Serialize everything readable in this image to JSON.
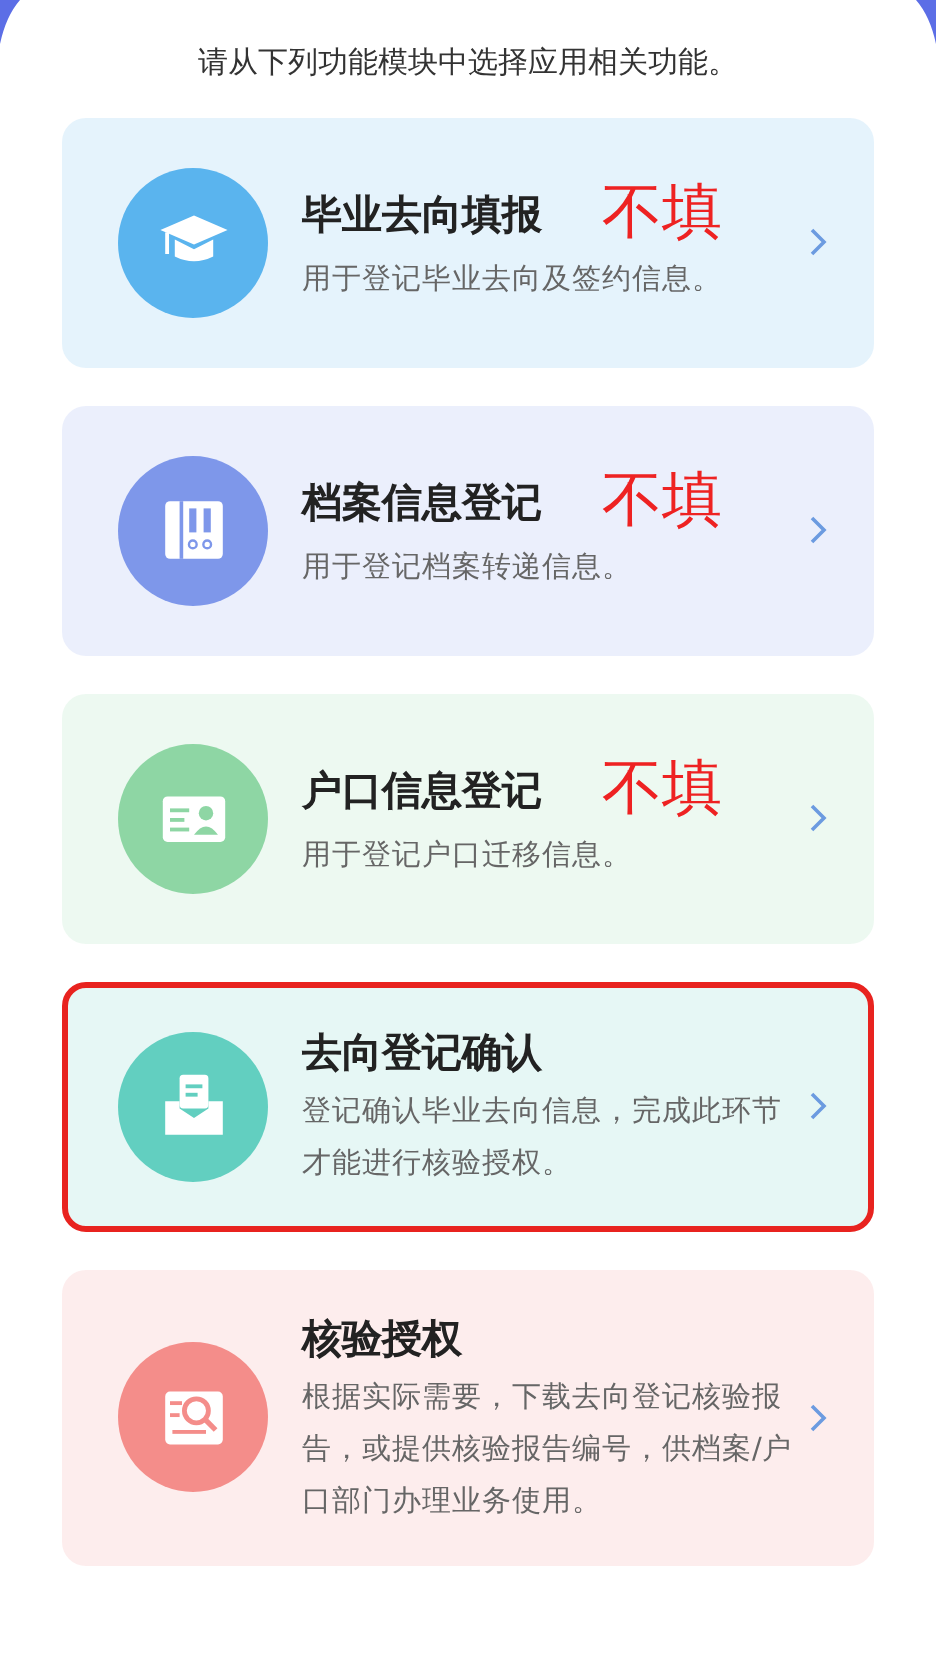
{
  "intro": "请从下列功能模块中选择应用相关功能。",
  "cards": [
    {
      "kind": "cap",
      "title": "毕业去向填报",
      "note": "不填",
      "description": "用于登记毕业去向及签约信息。",
      "color": "#5ab4ee",
      "highlighted": false
    },
    {
      "kind": "binder",
      "title": "档案信息登记",
      "note": "不填",
      "description": "用于登记档案转递信息。",
      "color": "#7e97ea",
      "highlighted": false
    },
    {
      "kind": "idcard",
      "title": "户口信息登记",
      "note": "不填",
      "description": "用于登记户口迁移信息。",
      "color": "#8ed6a4",
      "highlighted": false
    },
    {
      "kind": "envelope",
      "title": "去向登记确认",
      "description": "登记确认毕业去向信息，完成此环节才能进行核验授权。",
      "color": "#62cfc0",
      "highlighted": true
    },
    {
      "kind": "report",
      "title": "核验授权",
      "description": "根据实际需要，下载去向登记核验报告，或提供核验报告编号，供档案/户口部门办理业务使用。",
      "color": "#f48d8a",
      "highlighted": false
    }
  ]
}
